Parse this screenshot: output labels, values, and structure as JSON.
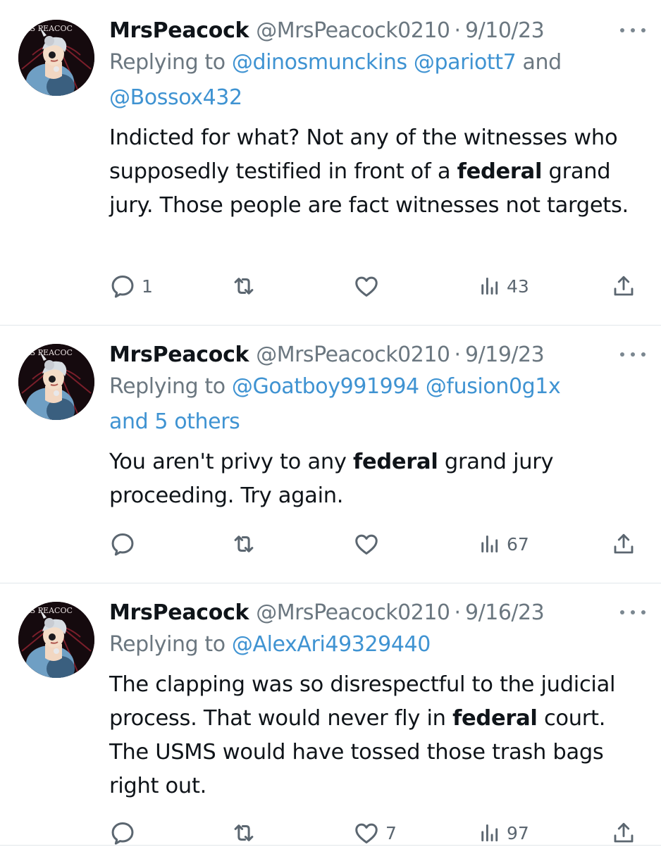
{
  "tweets": [
    {
      "name": "MrsPeacock",
      "handle": "@MrsPeacock0210",
      "separator": "·",
      "date": "9/10/23",
      "replying_prefix": "Replying to",
      "replying_line1_mentions": "@dinosmunckins @pariott7",
      "replying_line1_suffix": "and",
      "replying_line2_mentions": "@Bossox432",
      "body": {
        "p1": "Indicted for what? Not any of the witnesses who supposedly testified in front of a",
        "bold1": "federal",
        "p2": "grand jury. Those people are fact witnesses not targets."
      },
      "reply_count": "1",
      "retweet_count": "",
      "like_count": "",
      "view_count": "43"
    },
    {
      "name": "MrsPeacock",
      "handle": "@MrsPeacock0210",
      "separator": "·",
      "date": "9/19/23",
      "replying_prefix": "Replying to",
      "replying_line1_mentions": "@Goatboy991994 @fusion0g1x",
      "replying_line2_mentions": "and 5 others",
      "body": {
        "p1": "You aren't privy to any",
        "bold1": "federal",
        "p2": "grand jury proceeding. Try again."
      },
      "reply_count": "",
      "retweet_count": "",
      "like_count": "",
      "view_count": "67"
    },
    {
      "name": "MrsPeacock",
      "handle": "@MrsPeacock0210",
      "separator": "·",
      "date": "9/16/23",
      "replying_prefix": "Replying to",
      "replying_line1_mentions": "@AlexAri49329440",
      "body": {
        "p1": "The clapping was so disrespectful to the judicial process. That would never fly in",
        "bold1": "federal",
        "p2": "court. The USMS would have tossed those trash bags right out."
      },
      "reply_count": "",
      "retweet_count": "",
      "like_count": "7",
      "view_count": "97"
    }
  ],
  "avatar_text": "IRS PEACOC",
  "icons": [
    "reply-icon",
    "retweet-icon",
    "like-icon",
    "views-icon",
    "share-icon",
    "more-icon"
  ],
  "colors": {
    "mention": "#3f93d2",
    "muted": "#6b7780",
    "text": "#0f1419",
    "divider": "#e1e6ea"
  }
}
